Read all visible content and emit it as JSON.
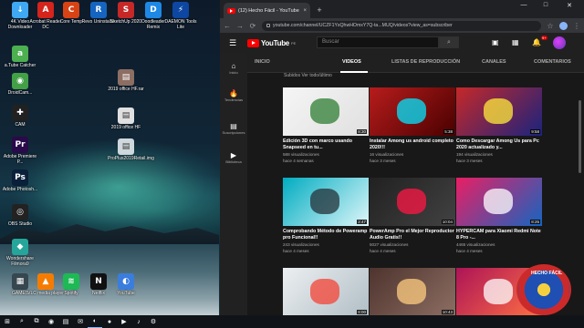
{
  "desktop": {
    "icons": [
      {
        "label": "4K Video Downloader",
        "color": "#3fa9f5",
        "glyph": "↓"
      },
      {
        "label": "Acrobat Reader DC",
        "color": "#d4241b",
        "glyph": "A"
      },
      {
        "label": "Core Temp",
        "color": "#d84315",
        "glyph": "C"
      },
      {
        "label": "Revo Uninstaller",
        "color": "#1565c0",
        "glyph": "R"
      },
      {
        "label": "SketchUp 2020",
        "color": "#c62828",
        "glyph": "S"
      },
      {
        "label": "Doodleader Remix",
        "color": "#1e88e5",
        "glyph": "D"
      },
      {
        "label": "DAEMON Tools Lite",
        "color": "#0d47a1",
        "glyph": "⚡"
      },
      {
        "label": "a.Tube Catcher",
        "color": "#4caf50",
        "glyph": "a"
      },
      {
        "label": "DroidCam...",
        "color": "#43a047",
        "glyph": "◉"
      },
      {
        "label": "CAM",
        "color": "#212121",
        "glyph": "✚"
      },
      {
        "label": "Adobe Premiere P...",
        "color": "#2a0a4a",
        "glyph": "Pr"
      },
      {
        "label": "Adobe Photosh...",
        "color": "#0a1f3a",
        "glyph": "Ps"
      },
      {
        "label": "OBS Studio",
        "color": "#222222",
        "glyph": "◎"
      },
      {
        "label": "Wondershare Filmora9",
        "color": "#26a69a",
        "glyph": "◆"
      },
      {
        "label": "GAMES",
        "color": "#37474f",
        "glyph": "▦"
      },
      {
        "label": "VLC media player",
        "color": "#f57c00",
        "glyph": "▲"
      },
      {
        "label": "Spotify",
        "color": "#1db954",
        "glyph": "≋"
      },
      {
        "label": "Netflix",
        "color": "#111111",
        "glyph": "N"
      },
      {
        "label": "YouTube",
        "color": "#3b7ddd",
        "glyph": "◐"
      },
      {
        "label": "2019 office HF.rar",
        "color": "#8d6e63",
        "glyph": "▤"
      },
      {
        "label": "2019 office HF",
        "color": "#e0e0e0",
        "glyph": "▤"
      },
      {
        "label": "ProPlus2019Retail.img",
        "color": "#cfd8dc",
        "glyph": "▤"
      }
    ]
  },
  "browser": {
    "tab_title": "(12) Hecho Fácil - YouTube",
    "tab_close": "×",
    "new_tab": "+",
    "window_controls": [
      "—",
      "□",
      "✕"
    ],
    "url": "youtube.com/channel/UCZF1YsQhwHOmxY7Q-ta...MUQ/videos?view_as=subscriber",
    "nav": [
      "←",
      "→",
      "⟳"
    ]
  },
  "youtube": {
    "logo_text": "YouTube",
    "logo_region": "PE",
    "search_placeholder": "Buscar",
    "notification_count": "9+",
    "guide": [
      {
        "icon": "⌂",
        "label": "Inicio"
      },
      {
        "icon": "🔥",
        "label": "Tendencias"
      },
      {
        "icon": "▤",
        "label": "Suscripciones"
      },
      {
        "icon": "▶",
        "label": "Biblioteca"
      }
    ],
    "channel_tabs": [
      "INICIO",
      "VIDEOS",
      "LISTAS DE REPRODUCCIÓN",
      "CANALES",
      "COMENTARIOS"
    ],
    "active_tab": "VIDEOS",
    "sort_label": "Subidos     Ver todo/último",
    "videos": [
      {
        "title": "Edición 3D con marco usando Snapseed en tu...",
        "views": "588 visualizaciones",
        "age": "hace 4 semanas",
        "duration": "8:30",
        "thumb_bg": "linear-gradient(135deg,#f5f5f5,#e0e0e0)",
        "accent": "#2e7d32"
      },
      {
        "title": "Instalar Among us android completo 2020!!!",
        "views": "16 visualizaciones",
        "age": "hace 3 meses",
        "duration": "5:38",
        "thumb_bg": "linear-gradient(135deg,#b71c1c,#4a0000)",
        "accent": "#00e5ff"
      },
      {
        "title": "Como Descargar Among Us para Pc 2020 actualizado y...",
        "views": "194 visualizaciones",
        "age": "hace 3 meses",
        "duration": "9:58",
        "thumb_bg": "linear-gradient(135deg,#c62828,#1a237e)",
        "accent": "#ffeb3b"
      },
      {
        "title": "Comprobando Método de Poweramp pro Funcional!!",
        "views": "243 visualizaciones",
        "age": "hace 4 meses",
        "duration": "2:47",
        "thumb_bg": "linear-gradient(135deg,#00acc1,#e0f7fa)",
        "accent": "#263238"
      },
      {
        "title": "PowerAmp Pro el Mejor Reproductor Audio Gratis!!",
        "views": "5027 visualizaciones",
        "age": "hace 4 meses",
        "duration": "10:04",
        "thumb_bg": "linear-gradient(135deg,#212121,#424242)",
        "accent": "#ff1744"
      },
      {
        "title": "HYPERCAM para Xiaomi Redmi Note 8 Pro -...",
        "views": "4465 visualizaciones",
        "age": "hace 4 meses",
        "duration": "8:25",
        "thumb_bg": "linear-gradient(135deg,#e91e63,#1565c0)",
        "accent": "#ffffff"
      },
      {
        "title": "",
        "views": "",
        "age": "",
        "duration": "8:00",
        "thumb_bg": "linear-gradient(135deg,#eceff1,#b0bec5)",
        "accent": "#f44336"
      },
      {
        "title": "",
        "views": "",
        "age": "",
        "duration": "10:43",
        "thumb_bg": "linear-gradient(135deg,#4e342e,#8d6e63)",
        "accent": "#ffcc80"
      },
      {
        "title": "",
        "views": "",
        "age": "",
        "duration": "",
        "thumb_bg": "linear-gradient(135deg,#ad1457,#ff7043)",
        "accent": "#ffffff"
      }
    ],
    "watermark_text": "HECHO FÁCIL"
  },
  "taskbar": {
    "items": [
      "⊞",
      "⌕",
      "⧉",
      "◉",
      "▤",
      "✉",
      "◐",
      "●",
      "▶",
      "♪",
      "⚙"
    ]
  }
}
